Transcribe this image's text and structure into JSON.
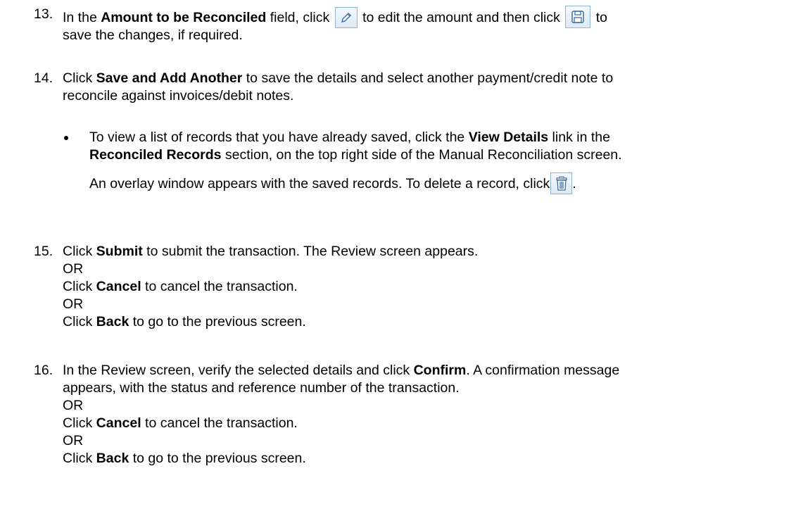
{
  "steps": {
    "s13": {
      "num": "13.",
      "pre": "In the ",
      "field": "Amount to be Reconciled",
      "mid1": " field, click ",
      "mid2": " to edit the amount and then click ",
      "post": " to",
      "line2": "save the changes, if required.",
      "edit_icon": "pencil-edit-icon",
      "save_icon": "floppy-save-icon"
    },
    "s14": {
      "num": "14.",
      "pre": "Click ",
      "action": "Save and Add Another",
      "post": " to save the details and select another payment/credit note to",
      "line2": "reconcile against invoices/debit notes.",
      "bullet": {
        "l1_pre": "To view a list of records that you have already saved, click the ",
        "l1_link": "View Details",
        "l1_post": " link in the",
        "l2_section": "Reconciled Records",
        "l2_post": " section, on the top right side of the Manual Reconciliation screen.",
        "l3": "An overlay window appears with the saved records. To delete a record, click",
        "l3_end": ".",
        "delete_icon": "trash-delete-icon"
      }
    },
    "s15": {
      "num": "15.",
      "l1_pre": "Click ",
      "l1_bold": "Submit",
      "l1_post": " to submit the transaction. The Review screen appears.",
      "or1": "OR",
      "l3_pre": "Click ",
      "l3_bold": "Cancel",
      "l3_post": " to cancel the transaction.",
      "or2": "OR",
      "l5_pre": "Click ",
      "l5_bold": "Back",
      "l5_post": " to go to the previous screen."
    },
    "s16": {
      "num": "16.",
      "l1_pre": "In the Review screen, verify the selected details and click ",
      "l1_bold": "Confirm",
      "l1_post": ". A confirmation message",
      "l2": "appears, with the status and reference number of the transaction.",
      "or1": "OR",
      "l4_pre": "Click ",
      "l4_bold": "Cancel",
      "l4_post": " to cancel the transaction.",
      "or2": "OR",
      "l6_pre": "Click ",
      "l6_bold": "Back",
      "l6_post": " to go to the previous screen."
    }
  }
}
